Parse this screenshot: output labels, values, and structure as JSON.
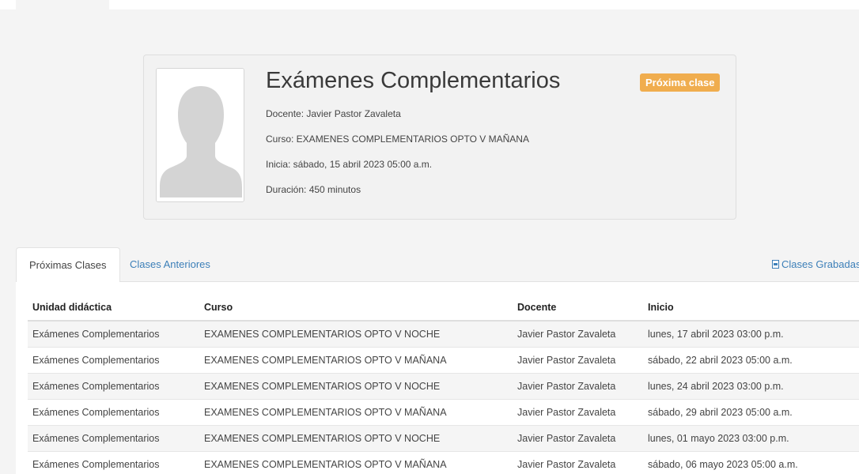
{
  "card": {
    "title": "Exámenes Complementarios",
    "badge": "Próxima clase",
    "docente": "Docente: Javier Pastor Zavaleta",
    "curso": "Curso: EXAMENES COMPLEMENTARIOS OPTO V MAÑANA",
    "inicia": "Inicia: sábado, 15 abril 2023 05:00 a.m.",
    "duracion": "Duración: 450 minutos"
  },
  "tabs": {
    "proximas": "Próximas Clases",
    "anteriores": "Clases Anteriores",
    "grabadas": "Clases Grabadas"
  },
  "table": {
    "headers": [
      "Unidad didáctica",
      "Curso",
      "Docente",
      "Inicio"
    ],
    "rows": [
      [
        "Exámenes Complementarios",
        "EXAMENES COMPLEMENTARIOS OPTO V NOCHE",
        "Javier Pastor Zavaleta",
        "lunes, 17 abril 2023 03:00 p.m."
      ],
      [
        "Exámenes Complementarios",
        "EXAMENES COMPLEMENTARIOS OPTO V MAÑANA",
        "Javier Pastor Zavaleta",
        "sábado, 22 abril 2023 05:00 a.m."
      ],
      [
        "Exámenes Complementarios",
        "EXAMENES COMPLEMENTARIOS OPTO V NOCHE",
        "Javier Pastor Zavaleta",
        "lunes, 24 abril 2023 03:00 p.m."
      ],
      [
        "Exámenes Complementarios",
        "EXAMENES COMPLEMENTARIOS OPTO V MAÑANA",
        "Javier Pastor Zavaleta",
        "sábado, 29 abril 2023 05:00 a.m."
      ],
      [
        "Exámenes Complementarios",
        "EXAMENES COMPLEMENTARIOS OPTO V NOCHE",
        "Javier Pastor Zavaleta",
        "lunes, 01 mayo 2023 03:00 p.m."
      ],
      [
        "Exámenes Complementarios",
        "EXAMENES COMPLEMENTARIOS OPTO V MAÑANA",
        "Javier Pastor Zavaleta",
        "sábado, 06 mayo 2023 05:00 a.m."
      ]
    ]
  },
  "colors": {
    "badge": "#f0ad4e",
    "link": "#3c7fb8",
    "background": "#f4f4f4"
  },
  "icons": {
    "avatar": "user-silhouette-icon",
    "recorded": "document-icon"
  }
}
